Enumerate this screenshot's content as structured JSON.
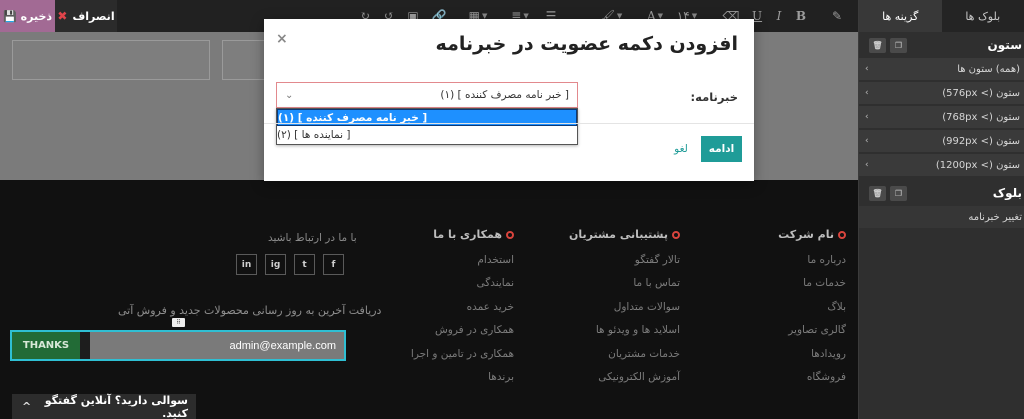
{
  "toolbar": {
    "save_label": "ذخیره",
    "discard_label": "انصراف",
    "font_size": "۱۴",
    "tools": [
      "magic-wand",
      "bold",
      "italic",
      "underline",
      "eraser",
      "font-color",
      "font-size",
      "brush",
      "list-unordered",
      "list-ordered",
      "table",
      "link",
      "image",
      "media",
      "undo",
      "redo"
    ]
  },
  "sidebar": {
    "tabs": [
      "بلوک ها",
      "گزینه ها"
    ],
    "active_tab": "گزینه ها",
    "column_section": "ستون",
    "column_rows": [
      "(همه) ستون ها",
      "ستون (> 576px)",
      "ستون (> 768px)",
      "ستون (> 992px)",
      "ستون (> 1200px)"
    ],
    "block_section": "بلوک",
    "block_rows": [
      "تغییر خبرنامه"
    ]
  },
  "modal": {
    "title": "افزودن دکمه عضویت در خبرنامه",
    "close": "×",
    "field_label": "خبرنامه:",
    "selected": "[ خبر نامه مصرف کننده ] (۱)",
    "options": [
      "[ خبر نامه مصرف کننده ] (۱)",
      "[ نماینده ها ] (۲)"
    ],
    "continue_label": "ادامه",
    "cancel_label": "لغو"
  },
  "footer": {
    "columns": [
      {
        "title": "نام شرکت",
        "links": [
          "درباره ما",
          "خدمات ما",
          "بلاگ",
          "گالری تصاویر",
          "رویدادها",
          "فروشگاه"
        ]
      },
      {
        "title": "پشتیبانی مشتریان",
        "links": [
          "تالار گفتگو",
          "تماس با ما",
          "سوالات متداول",
          "اسلاید ها و ویدئو ها",
          "خدمات مشتریان",
          "آموزش الکترونیکی"
        ]
      },
      {
        "title": "همکاری با ما",
        "links": [
          "استخدام",
          "نمایندگی",
          "خرید عمده",
          "همکاری در فروش",
          "همکاری در تامین و اجرا",
          "برندها"
        ]
      }
    ],
    "contact_title": "با ما در ارتباط باشید",
    "social": [
      "f",
      "t",
      "ig",
      "in"
    ],
    "newsletter_title": "دریافت آخرین به روز رسانی محصولات جدید و فروش آتی",
    "newsletter_email": "admin@example.com",
    "newsletter_button": "THANKS"
  },
  "chat": {
    "text": "سوالی دارید؟ آنلاین گفتگو کنید.",
    "up": "^"
  },
  "colors": {
    "save_bg": "#a26a94",
    "accent_teal": "#1f9c98",
    "selection_blue": "#1e90ff",
    "footer_bullet": "#d9443d",
    "form_outline": "#2fbfd3",
    "thanks_green": "#226b36"
  }
}
